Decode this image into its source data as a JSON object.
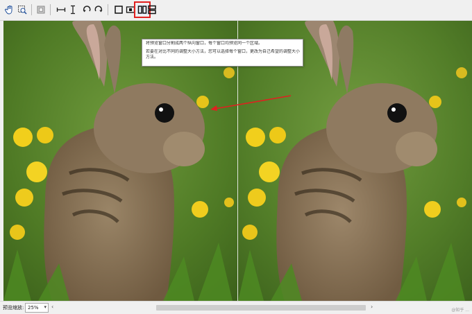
{
  "toolbar": {
    "buttons": [
      {
        "name": "hand-tool-icon"
      },
      {
        "name": "zoom-tool-icon"
      },
      {
        "name": "crop-icon"
      },
      {
        "name": "flip-horizontal-icon"
      },
      {
        "name": "flip-vertical-icon"
      },
      {
        "name": "rotate-left-icon"
      },
      {
        "name": "rotate-right-icon"
      },
      {
        "name": "single-view-icon"
      },
      {
        "name": "split-view-icon"
      },
      {
        "name": "side-by-side-vertical-icon"
      },
      {
        "name": "side-by-side-horizontal-icon"
      }
    ],
    "active_button": "side-by-side-vertical-icon"
  },
  "tooltip": {
    "line1": "将预览窗口分割成两个纵向窗口，每个窗口均预览同一个区域。",
    "line2": "若要在对比不同的调整大小方法，您可以选择每个窗口，更改为自己希望的调整大小方法。"
  },
  "statusbar": {
    "zoom_label": "预览缩放:",
    "zoom_value": "25%",
    "watermark": "@知乎 ..."
  },
  "colors": {
    "highlight": "#e02020",
    "arrow": "#e02020"
  }
}
